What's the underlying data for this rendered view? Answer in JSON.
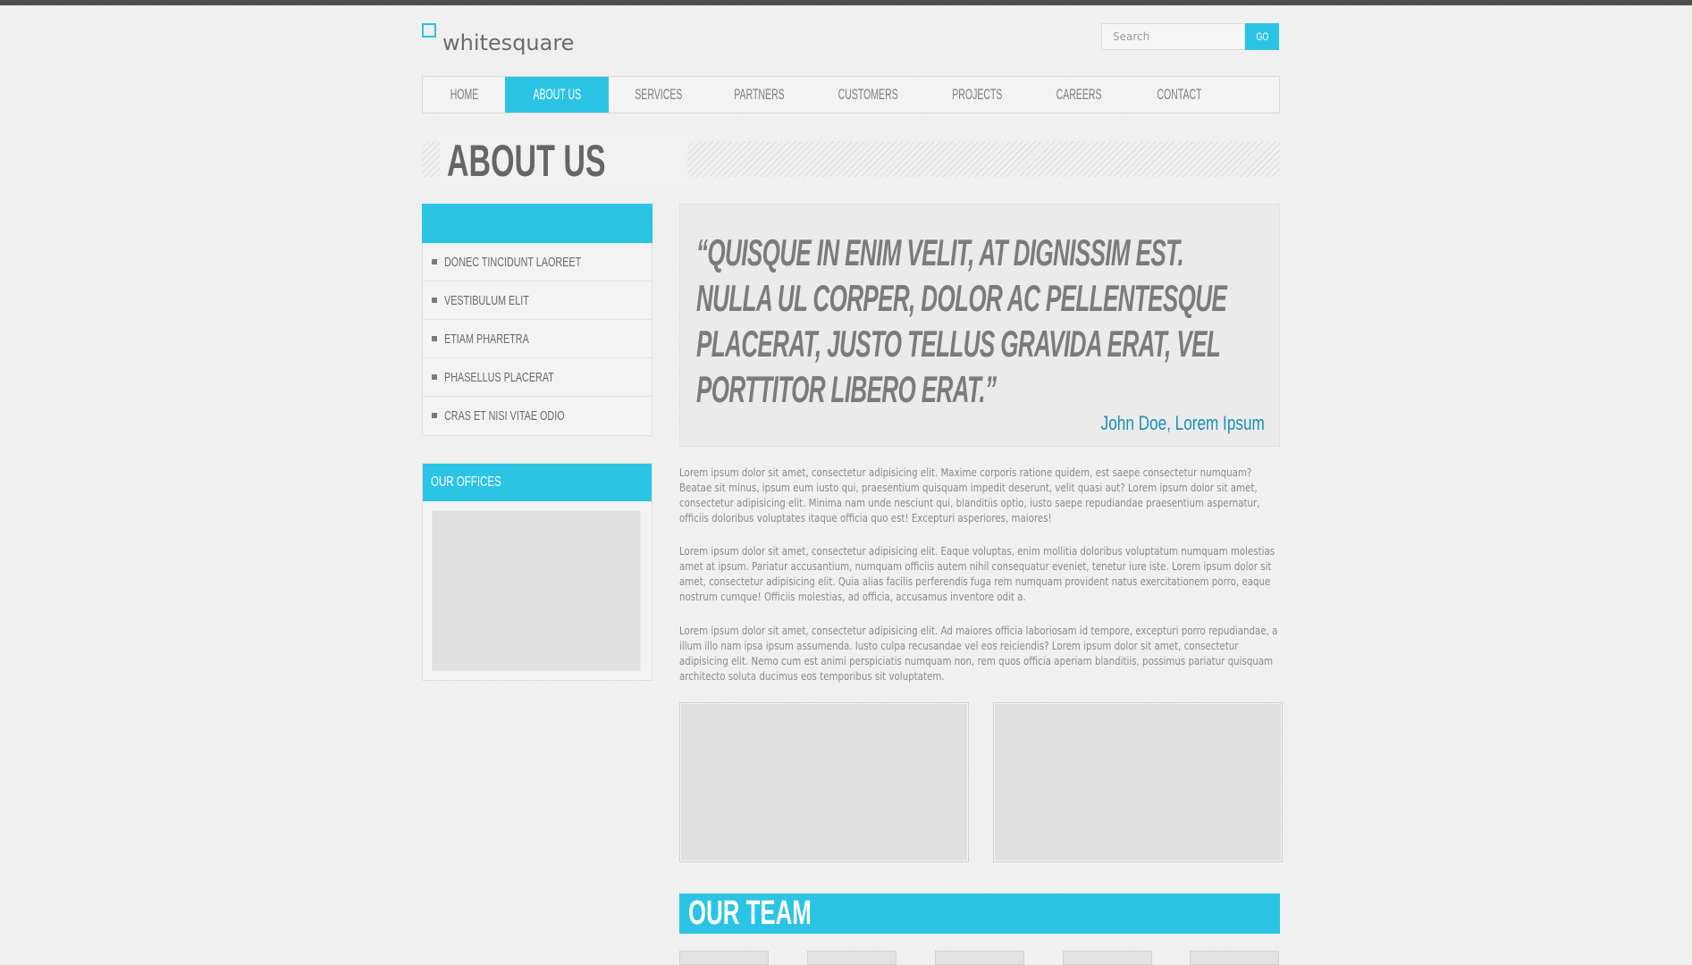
{
  "brand": {
    "name": "whitesquare",
    "accent_color": "#2bc4e4",
    "link_color": "#1b8fb3"
  },
  "search": {
    "placeholder": "Search",
    "button_label": "GO"
  },
  "nav": {
    "items": [
      {
        "label": "HOME",
        "active": false
      },
      {
        "label": "ABOUT US",
        "active": true
      },
      {
        "label": "SERVICES",
        "active": false
      },
      {
        "label": "PARTNERS",
        "active": false
      },
      {
        "label": "CUSTOMERS",
        "active": false
      },
      {
        "label": "PROJECTS",
        "active": false
      },
      {
        "label": "CAREERS",
        "active": false
      },
      {
        "label": "CONTACT",
        "active": false
      }
    ]
  },
  "page": {
    "title": "ABOUT US"
  },
  "sidebar": {
    "items": [
      {
        "label": "DONEC TINCIDUNT LAOREET"
      },
      {
        "label": "VESTIBULUM ELIT"
      },
      {
        "label": "ETIAM PHARETRA"
      },
      {
        "label": "PHASELLUS PLACERAT"
      },
      {
        "label": "CRAS ET NISI VITAE ODIO"
      }
    ],
    "offices_title": "OUR OFFICES"
  },
  "quote": {
    "lines": [
      "“QUISQUE IN ENIM VELIT, AT DIGNISSIM EST.",
      "NULLA UL CORPER, DOLOR AC PELLENTESQUE",
      "PLACERAT, JUSTO TELLUS GRAVIDA ERAT, VEL",
      "PORTTITOR LIBERO ERAT.”"
    ],
    "author": "John Doe, Lorem Ipsum"
  },
  "content": {
    "paragraphs": [
      "Lorem ipsum dolor sit amet, consectetur adipisicing elit. Maxime corporis ratione quidem, est saepe consectetur numquam? Beatae sit minus, ipsum eum iusto qui, praesentium quisquam impedit deserunt, velit quasi aut? Lorem ipsum dolor sit amet, consectetur adipisicing elit. Minima nam unde nesciunt qui, blanditiis optio, iusto saepe repudiandae praesentium aspernatur, officiis doloribus voluptates itaque officia quo est! Excepturi asperiores, maiores!",
      "Lorem ipsum dolor sit amet, consectetur adipisicing elit. Eaque voluptas, enim mollitia doloribus voluptatum numquam molestias amet at ipsum. Pariatur accusantium, numquam officiis autem nihil consequatur eveniet, tenetur iure iste. Lorem ipsum dolor sit amet, consectetur adipisicing elit. Quia alias facilis perferendis fuga rem numquam provident natus exercitationem porro, eaque nostrum cumque! Officiis molestias, ad officia, accusamus inventore odit a.",
      "Lorem ipsum dolor sit amet, consectetur adipisicing elit. Ad maiores officia laboriosam id tempore, excepturi porro repudiandae, a illum illo nam ipsa ipsum assumenda. Iusto culpa recusandae vel eos reiciendis? Lorem ipsum dolor sit amet, consectetur adipisicing elit. Nemo cum est animi perspiciatis numquam non, rem quos officia aperiam blanditiis, possimus pariatur quisquam architecto soluta ducimus eos temporibus sit voluptatem."
    ]
  },
  "team": {
    "title": "OUR TEAM"
  }
}
